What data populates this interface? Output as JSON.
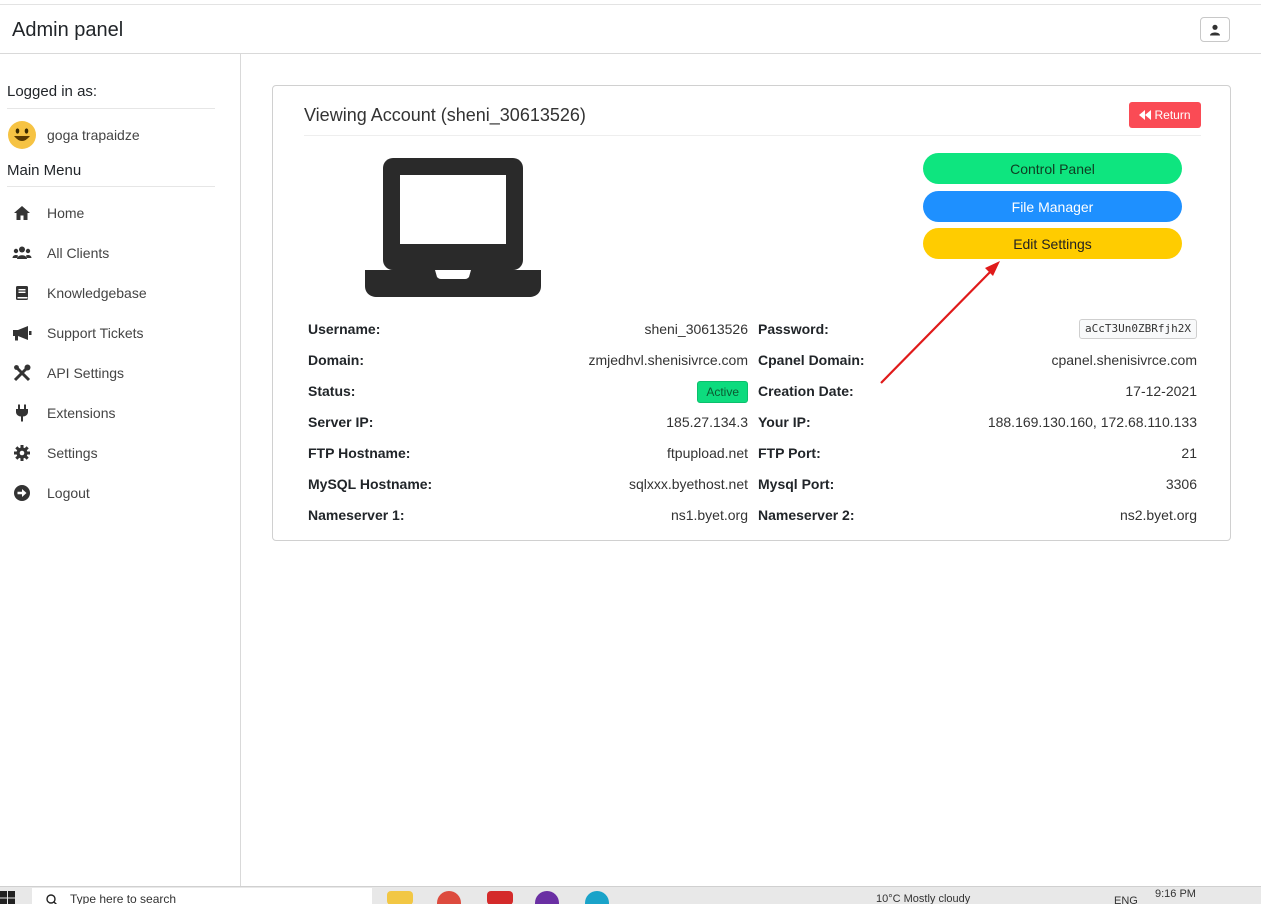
{
  "header": {
    "title": "Admin panel",
    "user_icon": "user-icon"
  },
  "sidebar": {
    "logged_in_heading": "Logged in as:",
    "user": {
      "name": "goga trapaidze",
      "avatar_icon": "smiley-emoji-icon"
    },
    "main_menu_heading": "Main Menu",
    "items": [
      {
        "label": "Home",
        "icon": "home-icon"
      },
      {
        "label": "All Clients",
        "icon": "users-icon"
      },
      {
        "label": "Knowledgebase",
        "icon": "book-icon"
      },
      {
        "label": "Support Tickets",
        "icon": "megaphone-icon"
      },
      {
        "label": "API Settings",
        "icon": "tools-icon"
      },
      {
        "label": "Extensions",
        "icon": "plug-icon"
      },
      {
        "label": "Settings",
        "icon": "gear-icon"
      },
      {
        "label": "Logout",
        "icon": "arrow-circle-right-icon"
      }
    ]
  },
  "card": {
    "title": "Viewing Account (sheni_30613526)",
    "return_label": "Return",
    "buttons": {
      "control_panel": "Control Panel",
      "file_manager": "File Manager",
      "edit_settings": "Edit Settings"
    },
    "details_left": [
      {
        "label": "Username:",
        "value": "sheni_30613526"
      },
      {
        "label": "Domain:",
        "value": "zmjedhvl.shenisivrce.com"
      },
      {
        "label": "Status:",
        "value": "Active"
      },
      {
        "label": "Server IP:",
        "value": "185.27.134.3"
      },
      {
        "label": "FTP Hostname:",
        "value": "ftpupload.net"
      },
      {
        "label": "MySQL Hostname:",
        "value": "sqlxxx.byethost.net"
      },
      {
        "label": "Nameserver 1:",
        "value": "ns1.byet.org"
      }
    ],
    "details_right": [
      {
        "label": "Password:",
        "value": "aCcT3Un0ZBRfjh2X"
      },
      {
        "label": "Cpanel Domain:",
        "value": "cpanel.shenisivrce.com"
      },
      {
        "label": "Creation Date:",
        "value": "17-12-2021"
      },
      {
        "label": "Your IP:",
        "value": "188.169.130.160, 172.68.110.133"
      },
      {
        "label": "FTP Port:",
        "value": "21"
      },
      {
        "label": "Mysql Port:",
        "value": "3306"
      },
      {
        "label": "Nameserver 2:",
        "value": "ns2.byet.org"
      }
    ]
  },
  "colors": {
    "return": "#fa4b55",
    "control_panel": "#0ee57f",
    "file_manager": "#1e90ff",
    "edit_settings": "#ffcc00",
    "active_badge": "#0ddb7e",
    "annotation_arrow": "#e01a1a"
  },
  "taskbar": {
    "search_placeholder": "Type here to search",
    "clock": "9:16 PM",
    "weather": "10°C  Mostly cloudy",
    "language": "ENG"
  }
}
